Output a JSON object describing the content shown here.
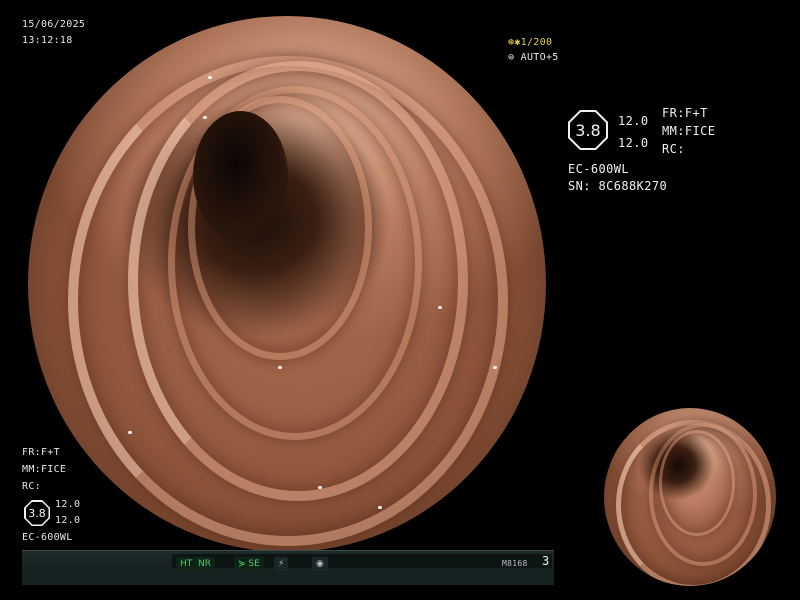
{
  "overlay": {
    "date": "15/06/2025",
    "time": "13:12:18",
    "shutter": "1/200",
    "exposure": "AUTO+5"
  },
  "right_panel": {
    "octagon_value": "3.8",
    "value_top": "12.0",
    "value_bottom": "12.0",
    "fr": "FR:F+T",
    "mm": "MM:FICE",
    "rc": "RC:",
    "scope": "EC-600WL",
    "serial": "SN: 8C688K270"
  },
  "left_panel": {
    "fr": "FR:F+T",
    "mm": "MM:FICE",
    "rc": "RC:",
    "octagon_value": "3.8",
    "value_top": "12.0",
    "value_bottom": "12.0",
    "scope": "EC-600WL"
  },
  "status_bar": {
    "ht": "HT",
    "nr": "NR",
    "se": "SE",
    "code": "M8168",
    "page": "3"
  },
  "icons": {
    "shutter_icon": "aperture-icon",
    "auto_icon": "exposure-icon",
    "se_icon": "enhance-icon",
    "flash_icon": "lightning-icon",
    "record_icon": "record-icon"
  }
}
